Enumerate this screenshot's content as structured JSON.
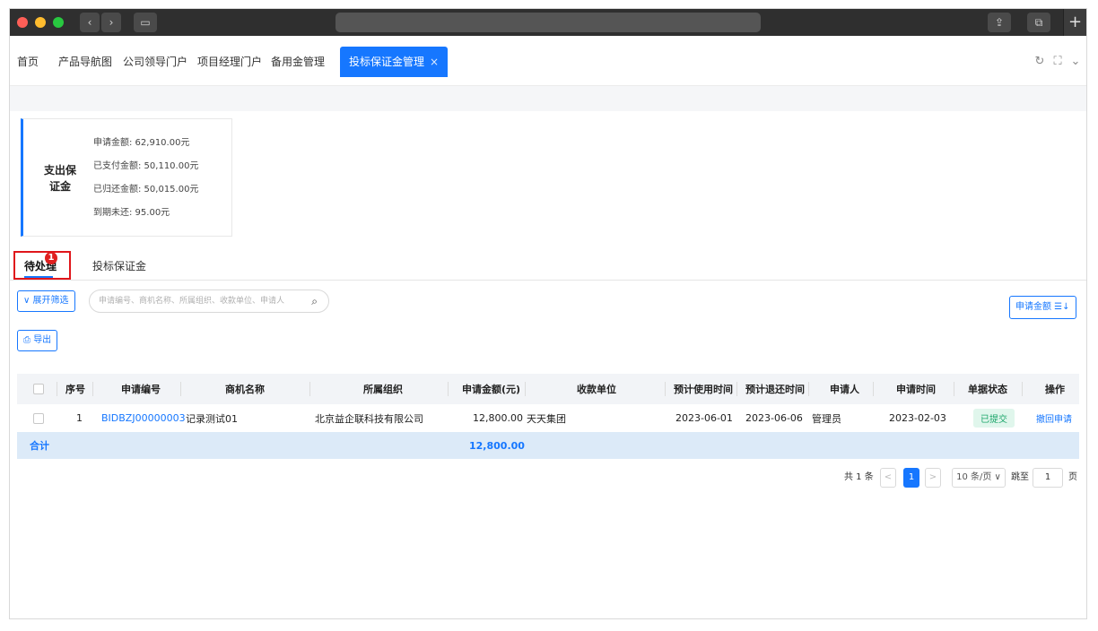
{
  "window": {
    "add_tab": "+"
  },
  "nav_tabs": [
    "首页",
    "产品导航图",
    "公司领导门户",
    "项目经理门户",
    "备用金管理",
    "投标保证金管理"
  ],
  "active_tab_close": "×",
  "stat_card": {
    "title": "支出保证金",
    "lines": [
      "申请金额: 62,910.00元",
      "已支付金额: 50,110.00元",
      "已归还金额: 50,015.00元",
      "到期未还: 95.00元"
    ]
  },
  "sub_tabs": {
    "pending": "待处理",
    "pending_badge": "1",
    "deposit": "投标保证金"
  },
  "filters": {
    "expand_label": "∨ 展开筛选",
    "search_placeholder": "申请编号、商机名称、所属组织、收款单位、申请人",
    "sort_label": "申请金额 ☰↓",
    "export_label": "导出"
  },
  "table": {
    "headers": [
      "序号",
      "申请编号",
      "商机名称",
      "所属组织",
      "申请金额(元)",
      "收款单位",
      "预计使用时间",
      "预计退还时间",
      "申请人",
      "申请时间",
      "单据状态",
      "操作"
    ],
    "rows": [
      {
        "index": "1",
        "apply_no": "BIDBZJ00000003",
        "opportunity": "记录测试01",
        "organization": "北京益企联科技有限公司",
        "amount": "12,800.00",
        "payee": "天天集团",
        "use_date": "2023-06-01",
        "return_date": "2023-06-06",
        "applicant": "管理员",
        "apply_date": "2023-02-03",
        "status": "已提交",
        "action": "撤回申请"
      }
    ],
    "total_label": "合计",
    "total_amount": "12,800.00"
  },
  "pagination": {
    "total_text": "共 1 条",
    "prev": "<",
    "current_page": "1",
    "next": ">",
    "page_size": "10 条/页 ∨",
    "jump_label": "跳至",
    "jump_value": "1",
    "page_unit": "页"
  }
}
